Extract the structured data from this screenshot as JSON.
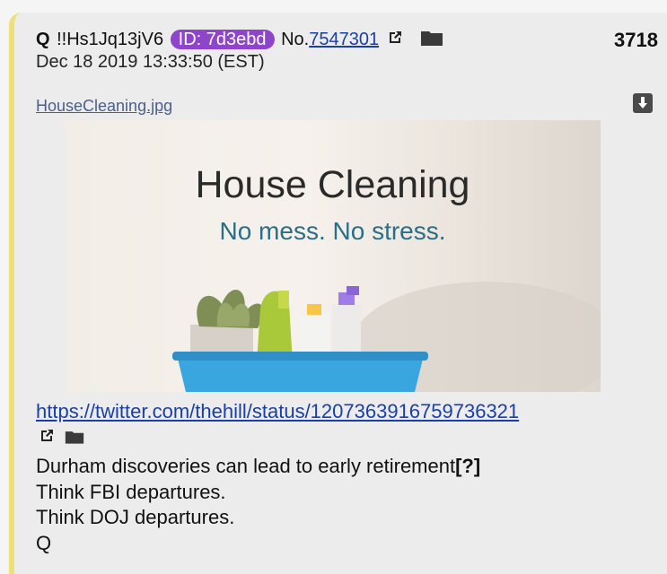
{
  "post": {
    "name": "Q",
    "trip": "!!Hs1Jq13jV6",
    "id_label": "ID: 7d3ebd",
    "no_prefix": "No.",
    "post_number": "7547301",
    "count": "3718",
    "date": "Dec 18 2019 13:33:50 (EST)",
    "filename": "HouseCleaning.jpg",
    "image": {
      "title": "House Cleaning",
      "subtitle": "No mess. No stress."
    },
    "link": "https://twitter.com/thehill/status/1207363916759736321",
    "lines": [
      "Durham discoveries can lead to early retirement",
      "Think FBI departures.",
      "Think DOJ departures.",
      "Q"
    ],
    "question_mark": "[?]"
  },
  "colors": {
    "accent_border": "#ede07a",
    "id_badge": "#8e45c9",
    "link": "#1a3fa8"
  }
}
